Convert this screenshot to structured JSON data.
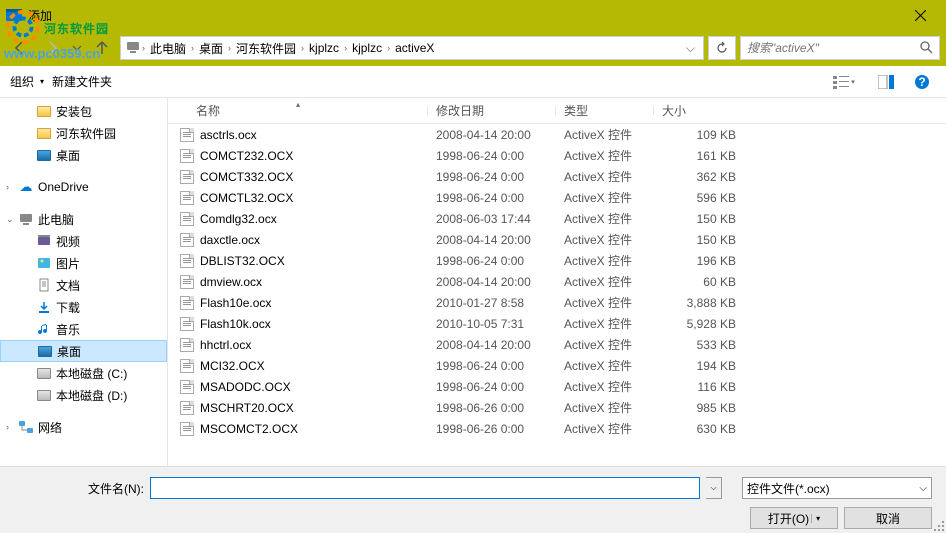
{
  "window": {
    "title": "添加"
  },
  "breadcrumb": [
    "此电脑",
    "桌面",
    "河东软件园",
    "kjplzc",
    "kjplzc",
    "activeX"
  ],
  "search": {
    "placeholder": "搜索\"activeX\""
  },
  "toolbar": {
    "organize": "组织",
    "new_folder": "新建文件夹"
  },
  "watermark": {
    "text": "河东软件园",
    "url": "www.pc0359.cn"
  },
  "sidebar": {
    "quick": [
      {
        "label": "安装包",
        "icon": "folder"
      },
      {
        "label": "河东软件园",
        "icon": "folder"
      },
      {
        "label": "桌面",
        "icon": "screen"
      }
    ],
    "onedrive": "OneDrive",
    "thispc": "此电脑",
    "pc_items": [
      {
        "label": "视频",
        "icon": "folder"
      },
      {
        "label": "图片",
        "icon": "folder"
      },
      {
        "label": "文档",
        "icon": "folder"
      },
      {
        "label": "下载",
        "icon": "folder"
      },
      {
        "label": "音乐",
        "icon": "folder"
      },
      {
        "label": "桌面",
        "icon": "screen",
        "selected": true
      },
      {
        "label": "本地磁盘 (C:)",
        "icon": "drive"
      },
      {
        "label": "本地磁盘 (D:)",
        "icon": "drive"
      }
    ],
    "network": "网络"
  },
  "columns": {
    "name": "名称",
    "date": "修改日期",
    "type": "类型",
    "size": "大小"
  },
  "files": [
    {
      "name": "asctrls.ocx",
      "date": "2008-04-14 20:00",
      "type": "ActiveX 控件",
      "size": "109 KB"
    },
    {
      "name": "COMCT232.OCX",
      "date": "1998-06-24 0:00",
      "type": "ActiveX 控件",
      "size": "161 KB"
    },
    {
      "name": "COMCT332.OCX",
      "date": "1998-06-24 0:00",
      "type": "ActiveX 控件",
      "size": "362 KB"
    },
    {
      "name": "COMCTL32.OCX",
      "date": "1998-06-24 0:00",
      "type": "ActiveX 控件",
      "size": "596 KB"
    },
    {
      "name": "Comdlg32.ocx",
      "date": "2008-06-03 17:44",
      "type": "ActiveX 控件",
      "size": "150 KB"
    },
    {
      "name": "daxctle.ocx",
      "date": "2008-04-14 20:00",
      "type": "ActiveX 控件",
      "size": "150 KB"
    },
    {
      "name": "DBLIST32.OCX",
      "date": "1998-06-24 0:00",
      "type": "ActiveX 控件",
      "size": "196 KB"
    },
    {
      "name": "dmview.ocx",
      "date": "2008-04-14 20:00",
      "type": "ActiveX 控件",
      "size": "60 KB"
    },
    {
      "name": "Flash10e.ocx",
      "date": "2010-01-27 8:58",
      "type": "ActiveX 控件",
      "size": "3,888 KB"
    },
    {
      "name": "Flash10k.ocx",
      "date": "2010-10-05 7:31",
      "type": "ActiveX 控件",
      "size": "5,928 KB"
    },
    {
      "name": "hhctrl.ocx",
      "date": "2008-04-14 20:00",
      "type": "ActiveX 控件",
      "size": "533 KB"
    },
    {
      "name": "MCI32.OCX",
      "date": "1998-06-24 0:00",
      "type": "ActiveX 控件",
      "size": "194 KB"
    },
    {
      "name": "MSADODC.OCX",
      "date": "1998-06-24 0:00",
      "type": "ActiveX 控件",
      "size": "116 KB"
    },
    {
      "name": "MSCHRT20.OCX",
      "date": "1998-06-26 0:00",
      "type": "ActiveX 控件",
      "size": "985 KB"
    },
    {
      "name": "MSCOMCT2.OCX",
      "date": "1998-06-26 0:00",
      "type": "ActiveX 控件",
      "size": "630 KB"
    }
  ],
  "footer": {
    "filename_label": "文件名(N):",
    "filename_value": "",
    "filter": "控件文件(*.ocx)",
    "open": "打开(O)",
    "cancel": "取消"
  }
}
